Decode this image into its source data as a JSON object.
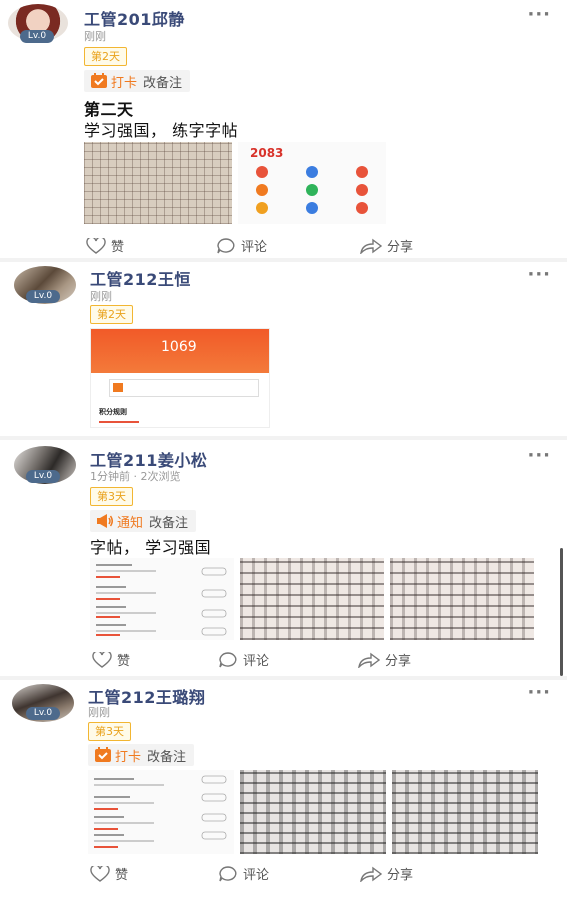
{
  "posts": [
    {
      "name": "工管201邱静",
      "level": "Lv.0",
      "time": "刚刚",
      "day_tag": "第2天",
      "pill": {
        "label": "打卡",
        "note": "改备注",
        "icon": "checkin-calendar-icon"
      },
      "text_lines": [
        "第二天",
        "学习强国， 练字字帖"
      ],
      "photos": [
        "handwriting-grid-photo",
        "app-score-screenshot"
      ],
      "screenshot_score": "2083",
      "actions": {
        "like": "赞",
        "comment": "评论",
        "share": "分享"
      }
    },
    {
      "name": "工管212王恒",
      "level": "Lv.0",
      "time": "刚刚",
      "day_tag": "第2天",
      "photos": [
        "app-points-screenshot"
      ],
      "screenshot_points": "1069",
      "screenshot_section": "积分规则"
    },
    {
      "name": "工管211姜小松",
      "level": "Lv.0",
      "time": "1分钟前 · 2次浏览",
      "day_tag": "第3天",
      "pill": {
        "label": "通知",
        "note": "改备注",
        "icon": "megaphone-icon"
      },
      "text_lines": [
        "字帖， 学习强国"
      ],
      "photos": [
        "app-task-list-screenshot",
        "handwriting-photo",
        "handwriting-photo"
      ],
      "actions": {
        "like": "赞",
        "comment": "评论",
        "share": "分享"
      }
    },
    {
      "name": "工管212王璐翔",
      "level": "Lv.0",
      "time": "刚刚",
      "day_tag": "第3天",
      "pill": {
        "label": "打卡",
        "note": "改备注",
        "icon": "checkin-calendar-icon"
      },
      "photos": [
        "app-task-list-screenshot",
        "handwriting-photo",
        "handwriting-photo"
      ],
      "actions": {
        "like": "赞",
        "comment": "评论",
        "share": "分享"
      }
    }
  ],
  "more_label": "···",
  "colors": {
    "accent_orange": "#f07a20",
    "tag_yellow": "#f2b632",
    "name_blue": "#3a4a78",
    "level_badge": "#4d6a8c"
  }
}
